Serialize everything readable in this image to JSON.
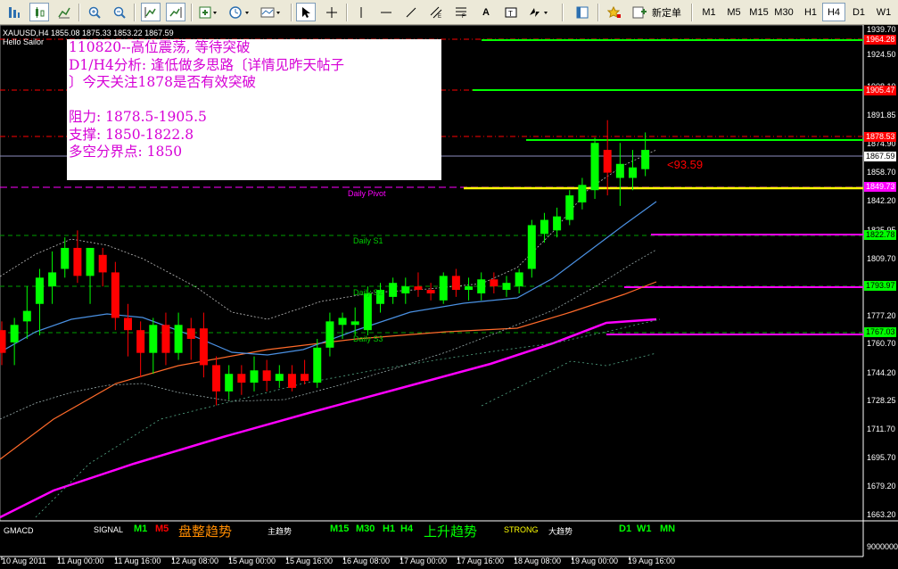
{
  "toolbar": {
    "new_order_label": "新定单",
    "timeframes": [
      "M1",
      "M5",
      "M15",
      "M30",
      "H1",
      "H4",
      "D1",
      "W1"
    ],
    "active_timeframe": "H4",
    "text_tool": "A"
  },
  "chart_header": {
    "line1": "XAUUSD,H4  1855.08 1875.33 1853.22 1867.59",
    "line2": "Hello Sailor"
  },
  "note_box": {
    "lines": [
      "110820--高位震荡, 等待突破",
      "D1/H4分析: 逢低做多思路〔详情见昨天帖子",
      "〕今天关注1878是否有效突破",
      "",
      "阻力: 1878.5-1905.5",
      "支撑: 1850-1822.8",
      "多空分界点: 1850"
    ]
  },
  "levels": {
    "daily_pivot": "Daily Pivot",
    "daily_s1": "Daily S1",
    "daily_s2": "Daily S2",
    "daily_s3": "Daily S3",
    "distance_label": "<93.59"
  },
  "price_axis": {
    "ticks": [
      "1939.70",
      "1924.50",
      "1908.10",
      "1891.85",
      "1874.90",
      "1858.70",
      "1842.20",
      "1825.95",
      "1809.70",
      "1793.20",
      "1777.20",
      "1760.70",
      "1744.20",
      "1728.25",
      "1711.70",
      "1695.70",
      "1679.20",
      "1663.20"
    ],
    "tags": [
      {
        "label": "1964.28",
        "color": "#ff0000"
      },
      {
        "label": "1905.47",
        "color": "#ff0000"
      },
      {
        "label": "1878.53",
        "color": "#ff0000"
      },
      {
        "label": "1867.59",
        "color": "#ffffff"
      },
      {
        "label": "1849.73",
        "color": "#ff00ff"
      },
      {
        "label": "1822.78",
        "color": "#00ff00"
      },
      {
        "label": "1793.97",
        "color": "#00ff00"
      },
      {
        "label": "1767.03",
        "color": "#00ff00"
      }
    ],
    "sub_label": "9000000"
  },
  "signal_bar": {
    "indicator": "GMACD",
    "signal": "SIGNAL",
    "m1": "M1",
    "m5": "M5",
    "consolidation": "盘整趋势",
    "main_trend": "主趋势",
    "tfs": [
      "M15",
      "M30",
      "H1",
      "H4"
    ],
    "uptrend": "上升趋势",
    "strong": "STRONG",
    "big_trend": "大趋势",
    "high_tfs": [
      "D1",
      "W1",
      "MN"
    ]
  },
  "time_axis": [
    "10 Aug 2011",
    "11 Aug 00:00",
    "11 Aug 16:00",
    "12 Aug 08:00",
    "15 Aug 00:00",
    "15 Aug 16:00",
    "16 Aug 08:00",
    "17 Aug 00:00",
    "17 Aug 16:00",
    "18 Aug 08:00",
    "19 Aug 00:00",
    "19 Aug 16:00"
  ],
  "colors": {
    "bull": "#00ff00",
    "bear": "#ff0000",
    "pivot": "#ffff00",
    "support": "#ff00ff",
    "ma_fast": "#4a90e2",
    "ma_mid": "#ff6a2a",
    "ma_slow": "#ff00ff"
  },
  "chart_data": {
    "type": "candlestick",
    "symbol": "XAUUSD",
    "timeframe": "H4",
    "ylim": [
      1655,
      1945
    ],
    "candles": [
      {
        "o": 1765,
        "h": 1770,
        "l": 1745,
        "c": 1752
      },
      {
        "o": 1758,
        "h": 1772,
        "l": 1745,
        "c": 1768
      },
      {
        "o": 1770,
        "h": 1790,
        "l": 1760,
        "c": 1776
      },
      {
        "o": 1780,
        "h": 1800,
        "l": 1762,
        "c": 1795
      },
      {
        "o": 1790,
        "h": 1810,
        "l": 1780,
        "c": 1798
      },
      {
        "o": 1800,
        "h": 1818,
        "l": 1795,
        "c": 1812
      },
      {
        "o": 1812,
        "h": 1822,
        "l": 1792,
        "c": 1796
      },
      {
        "o": 1796,
        "h": 1810,
        "l": 1780,
        "c": 1812
      },
      {
        "o": 1808,
        "h": 1812,
        "l": 1790,
        "c": 1798
      },
      {
        "o": 1798,
        "h": 1804,
        "l": 1765,
        "c": 1772
      },
      {
        "o": 1772,
        "h": 1780,
        "l": 1750,
        "c": 1765
      },
      {
        "o": 1765,
        "h": 1770,
        "l": 1738,
        "c": 1752
      },
      {
        "o": 1752,
        "h": 1772,
        "l": 1740,
        "c": 1768
      },
      {
        "o": 1768,
        "h": 1775,
        "l": 1745,
        "c": 1752
      },
      {
        "o": 1752,
        "h": 1775,
        "l": 1748,
        "c": 1768
      },
      {
        "o": 1766,
        "h": 1772,
        "l": 1748,
        "c": 1760
      },
      {
        "o": 1766,
        "h": 1775,
        "l": 1738,
        "c": 1745
      },
      {
        "o": 1745,
        "h": 1750,
        "l": 1722,
        "c": 1730
      },
      {
        "o": 1730,
        "h": 1745,
        "l": 1725,
        "c": 1740
      },
      {
        "o": 1740,
        "h": 1745,
        "l": 1728,
        "c": 1735
      },
      {
        "o": 1735,
        "h": 1750,
        "l": 1730,
        "c": 1742
      },
      {
        "o": 1742,
        "h": 1748,
        "l": 1730,
        "c": 1736
      },
      {
        "o": 1736,
        "h": 1745,
        "l": 1732,
        "c": 1740
      },
      {
        "o": 1740,
        "h": 1745,
        "l": 1730,
        "c": 1732
      },
      {
        "o": 1740,
        "h": 1748,
        "l": 1734,
        "c": 1736
      },
      {
        "o": 1735,
        "h": 1760,
        "l": 1732,
        "c": 1755
      },
      {
        "o": 1755,
        "h": 1775,
        "l": 1750,
        "c": 1770
      },
      {
        "o": 1768,
        "h": 1775,
        "l": 1760,
        "c": 1772
      },
      {
        "o": 1768,
        "h": 1778,
        "l": 1762,
        "c": 1770
      },
      {
        "o": 1765,
        "h": 1790,
        "l": 1762,
        "c": 1786
      },
      {
        "o": 1780,
        "h": 1792,
        "l": 1775,
        "c": 1788
      },
      {
        "o": 1784,
        "h": 1795,
        "l": 1780,
        "c": 1792
      },
      {
        "o": 1786,
        "h": 1795,
        "l": 1780,
        "c": 1790
      },
      {
        "o": 1790,
        "h": 1798,
        "l": 1784,
        "c": 1788
      },
      {
        "o": 1788,
        "h": 1792,
        "l": 1782,
        "c": 1786
      },
      {
        "o": 1782,
        "h": 1798,
        "l": 1780,
        "c": 1796
      },
      {
        "o": 1796,
        "h": 1800,
        "l": 1784,
        "c": 1788
      },
      {
        "o": 1788,
        "h": 1795,
        "l": 1782,
        "c": 1790
      },
      {
        "o": 1786,
        "h": 1798,
        "l": 1782,
        "c": 1794
      },
      {
        "o": 1794,
        "h": 1798,
        "l": 1786,
        "c": 1790
      },
      {
        "o": 1788,
        "h": 1796,
        "l": 1784,
        "c": 1792
      },
      {
        "o": 1790,
        "h": 1800,
        "l": 1786,
        "c": 1798
      },
      {
        "o": 1800,
        "h": 1828,
        "l": 1795,
        "c": 1825
      },
      {
        "o": 1820,
        "h": 1832,
        "l": 1815,
        "c": 1828
      },
      {
        "o": 1822,
        "h": 1835,
        "l": 1818,
        "c": 1830
      },
      {
        "o": 1828,
        "h": 1845,
        "l": 1825,
        "c": 1842
      },
      {
        "o": 1838,
        "h": 1852,
        "l": 1834,
        "c": 1848
      },
      {
        "o": 1845,
        "h": 1875,
        "l": 1840,
        "c": 1872
      },
      {
        "o": 1868,
        "h": 1885,
        "l": 1842,
        "c": 1855
      },
      {
        "o": 1852,
        "h": 1872,
        "l": 1836,
        "c": 1860
      },
      {
        "o": 1852,
        "h": 1868,
        "l": 1845,
        "c": 1858
      },
      {
        "o": 1857,
        "h": 1878,
        "l": 1853,
        "c": 1868
      }
    ]
  }
}
